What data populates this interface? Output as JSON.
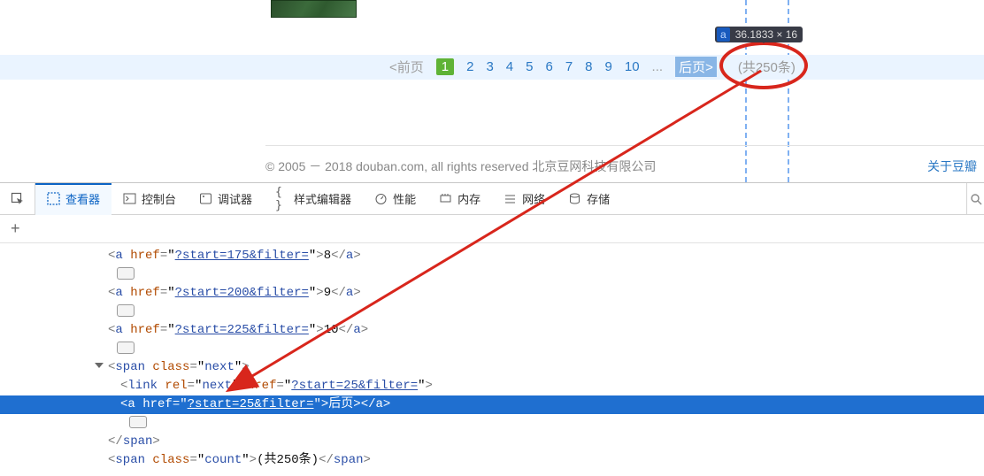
{
  "content": {
    "tooltip": {
      "tag": "a",
      "dims": "36.1833 × 16"
    },
    "pagination": {
      "prev": "<前页",
      "pages": [
        "1",
        "2",
        "3",
        "4",
        "5",
        "6",
        "7",
        "8",
        "9",
        "10"
      ],
      "ellipsis": "...",
      "next": "后页>",
      "count": "(共250条)"
    },
    "footer": {
      "copyright": "© 2005 － 2018 douban.com, all rights reserved 北京豆网科技有限公司",
      "about": "关于豆瓣"
    }
  },
  "devtools": {
    "tabs": {
      "inspector": "查看器",
      "console": "控制台",
      "debugger": "调试器",
      "style": "样式编辑器",
      "perf": "性能",
      "memory": "内存",
      "network": "网络",
      "storage": "存储"
    },
    "add": "+",
    "lines": [
      {
        "kind": "a",
        "href": "?start=175&filter=",
        "text": "8",
        "indent": 0
      },
      {
        "kind": "el",
        "indent": 0
      },
      {
        "kind": "a",
        "href": "?start=200&filter=",
        "text": "9",
        "indent": 0
      },
      {
        "kind": "el",
        "indent": 0
      },
      {
        "kind": "a",
        "href": "?start=225&filter=",
        "text": "10",
        "indent": 0
      },
      {
        "kind": "el",
        "indent": 0
      },
      {
        "kind": "span-open",
        "class": "next",
        "indent": 0
      },
      {
        "kind": "link",
        "rel": "next",
        "href": "?start=25&filter=",
        "indent": 1
      },
      {
        "kind": "a-hl",
        "href": "?start=25&filter=",
        "text": "后页>",
        "indent": 1
      },
      {
        "kind": "el",
        "indent": 1
      },
      {
        "kind": "span-close",
        "indent": 0
      },
      {
        "kind": "span-inline",
        "class": "count",
        "text": "(共250条)",
        "indent": 0
      }
    ]
  }
}
